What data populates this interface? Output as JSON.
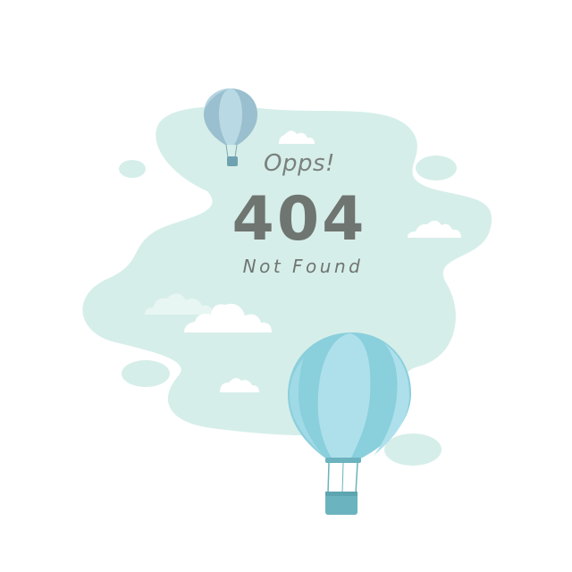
{
  "error_page": {
    "exclamation": "Opps!",
    "code": "404",
    "message": "Not Found"
  },
  "illustration": {
    "icons": [
      "hot-air-balloon-icon",
      "cloud-icon"
    ],
    "colors": {
      "blob": "#d6eee9",
      "cloud": "#ffffff",
      "balloon_light": "#aee0ec",
      "balloon_dark": "#8acfdc",
      "balloon_small_light": "#b3d4e0",
      "balloon_small_dark": "#9abfce",
      "basket": "#6bb3be",
      "text": "#6f7571"
    }
  }
}
